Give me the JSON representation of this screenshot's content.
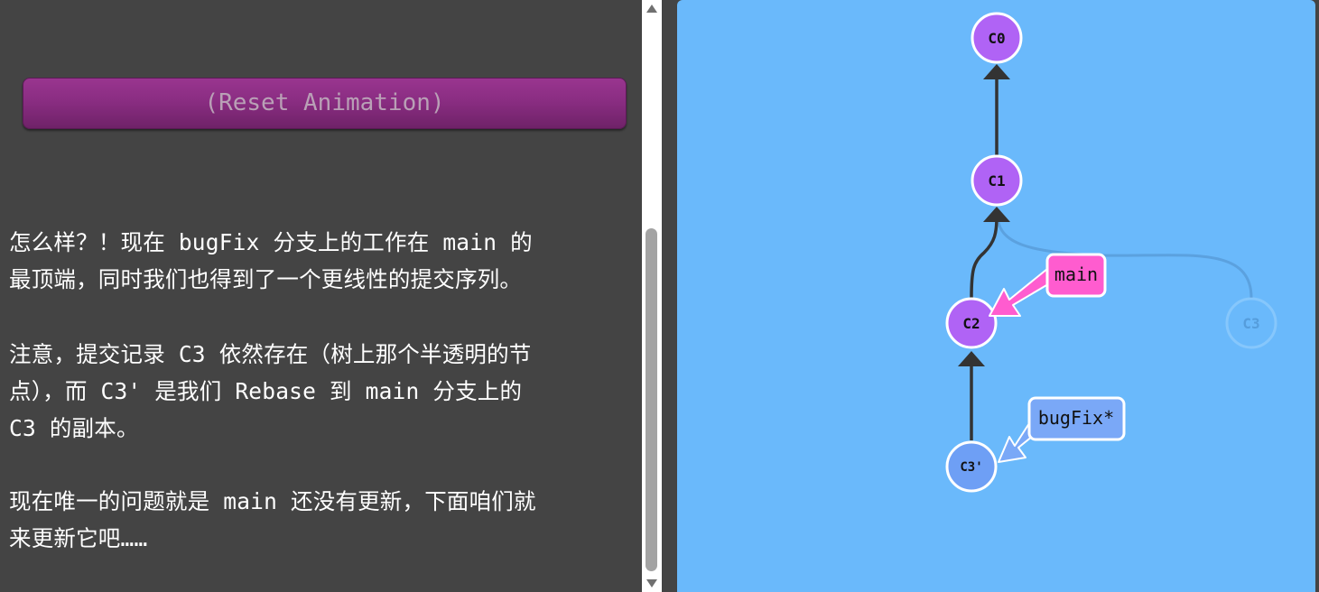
{
  "left_panel": {
    "reset_button_label": "(Reset Animation)",
    "paragraphs": [
      {
        "line1": "怎么样？！现在 bugFix 分支上的工作在 main 的",
        "line2": "最顶端，同时我们也得到了一个更线性的提交序列。"
      },
      {
        "line1": "注意，提交记录 C3 依然存在（树上那个半透明的节",
        "line2": "点），而 C3' 是我们 Rebase 到 main 分支上的",
        "line3": "C3 的副本。"
      },
      {
        "line1": "现在唯一的问题就是 main 还没有更新，下面咱们就",
        "line2": "来更新它吧……"
      }
    ]
  },
  "graph": {
    "background_color": "#6ab9fb",
    "commits": [
      {
        "id": "C0",
        "color": "#b063f5"
      },
      {
        "id": "C1",
        "color": "#b063f5"
      },
      {
        "id": "C2",
        "color": "#b063f5"
      },
      {
        "id": "C3",
        "color": "#6ab9fb",
        "ghost": true
      },
      {
        "id": "C3'",
        "color": "#6e9ff5"
      }
    ],
    "branches": [
      {
        "name": "main",
        "target": "C2",
        "color": "#ff5ccf"
      },
      {
        "name": "bugFix*",
        "target": "C3'",
        "color": "#7aa8f7"
      }
    ]
  }
}
